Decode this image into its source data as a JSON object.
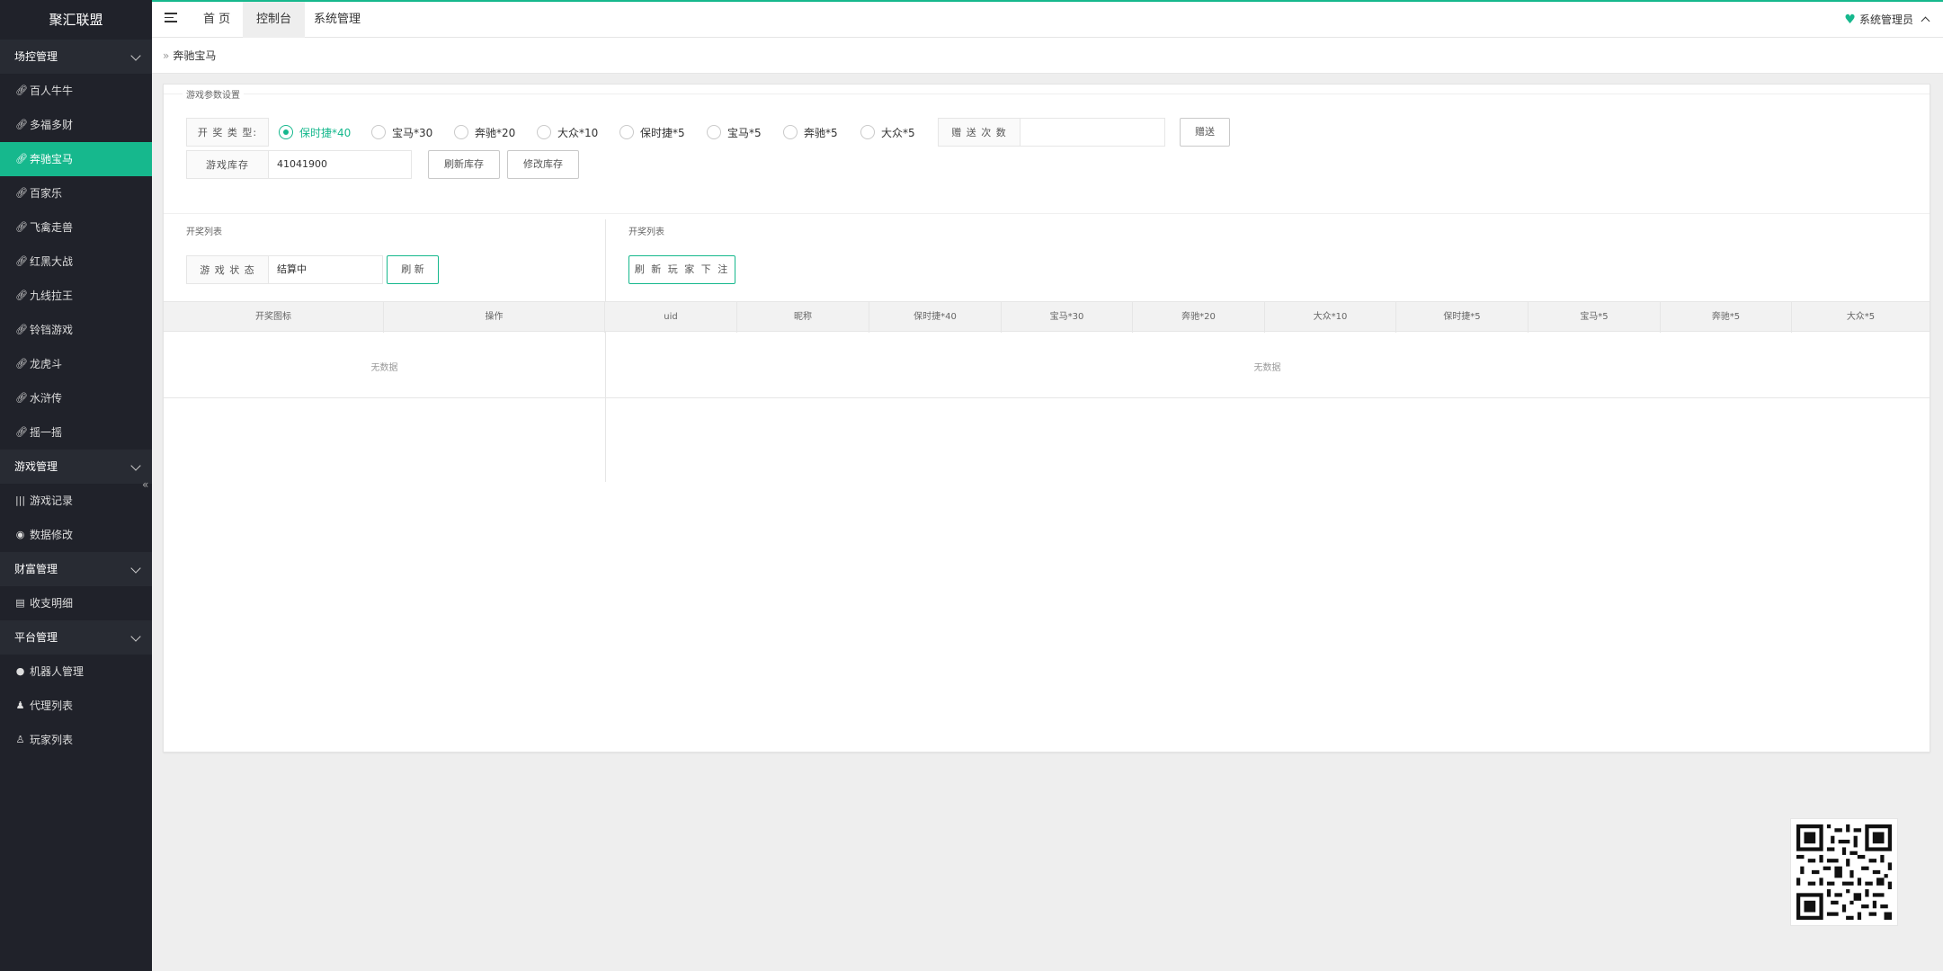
{
  "app": {
    "title": "聚汇联盟"
  },
  "sidebar": {
    "groups": [
      {
        "label": "场控管理",
        "items": [
          {
            "label": "百人牛牛",
            "icon": "link-icon"
          },
          {
            "label": "多福多财",
            "icon": "link-icon"
          },
          {
            "label": "奔驰宝马",
            "icon": "link-icon",
            "active": true
          },
          {
            "label": "百家乐",
            "icon": "link-icon"
          },
          {
            "label": "飞禽走兽",
            "icon": "link-icon"
          },
          {
            "label": "红黑大战",
            "icon": "link-icon"
          },
          {
            "label": "九线拉王",
            "icon": "link-icon"
          },
          {
            "label": "铃铛游戏",
            "icon": "link-icon"
          },
          {
            "label": "龙虎斗",
            "icon": "link-icon"
          },
          {
            "label": "水浒传",
            "icon": "link-icon"
          },
          {
            "label": "摇一摇",
            "icon": "link-icon"
          }
        ]
      },
      {
        "label": "游戏管理",
        "items": [
          {
            "label": "游戏记录",
            "icon": "barcode-icon"
          },
          {
            "label": "数据修改",
            "icon": "broadcast-icon"
          }
        ]
      },
      {
        "label": "财富管理",
        "items": [
          {
            "label": "收支明细",
            "icon": "receipt-icon"
          }
        ]
      },
      {
        "label": "平台管理",
        "items": [
          {
            "label": "机器人管理",
            "icon": "robot-icon"
          },
          {
            "label": "代理列表",
            "icon": "user-icon"
          },
          {
            "label": "玩家列表",
            "icon": "user-search-icon"
          }
        ]
      }
    ]
  },
  "topbar": {
    "tabs": [
      {
        "label": "首 页",
        "active": false
      },
      {
        "label": "控制台",
        "active": true
      },
      {
        "label": "系统管理",
        "active": false
      }
    ],
    "user": "系统管理员"
  },
  "breadcrumb": {
    "current": "奔驰宝马"
  },
  "params": {
    "legend": "游戏参数设置",
    "open_type_label": "开 奖 类 型:",
    "radios": [
      {
        "label": "保时捷*40",
        "checked": true
      },
      {
        "label": "宝马*30",
        "checked": false
      },
      {
        "label": "奔驰*20",
        "checked": false
      },
      {
        "label": "大众*10",
        "checked": false
      },
      {
        "label": "保时捷*5",
        "checked": false
      },
      {
        "label": "宝马*5",
        "checked": false
      },
      {
        "label": "奔驰*5",
        "checked": false
      },
      {
        "label": "大众*5",
        "checked": false
      }
    ],
    "gift_label": "赠 送 次 数",
    "gift_value": "",
    "gift_button": "赠送",
    "stock_label": "游戏库存",
    "stock_value": "41041900",
    "refresh_stock_button": "刷新库存",
    "modify_stock_button": "修改库存"
  },
  "left_panel": {
    "legend": "开奖列表",
    "status_label": "游 戏 状 态",
    "status_value": "结算中",
    "refresh_button": "刷 新",
    "columns": [
      "开奖图标",
      "操作"
    ],
    "empty_text": "无数据"
  },
  "right_panel": {
    "legend": "开奖列表",
    "refresh_bets_button": "刷 新 玩 家 下 注",
    "columns": [
      "uid",
      "昵称",
      "保时捷*40",
      "宝马*30",
      "奔驰*20",
      "大众*10",
      "保时捷*5",
      "宝马*5",
      "奔驰*5",
      "大众*5"
    ],
    "empty_text": "无数据"
  },
  "colors": {
    "accent": "#16b88d",
    "sidebar_bg": "#20222a"
  }
}
